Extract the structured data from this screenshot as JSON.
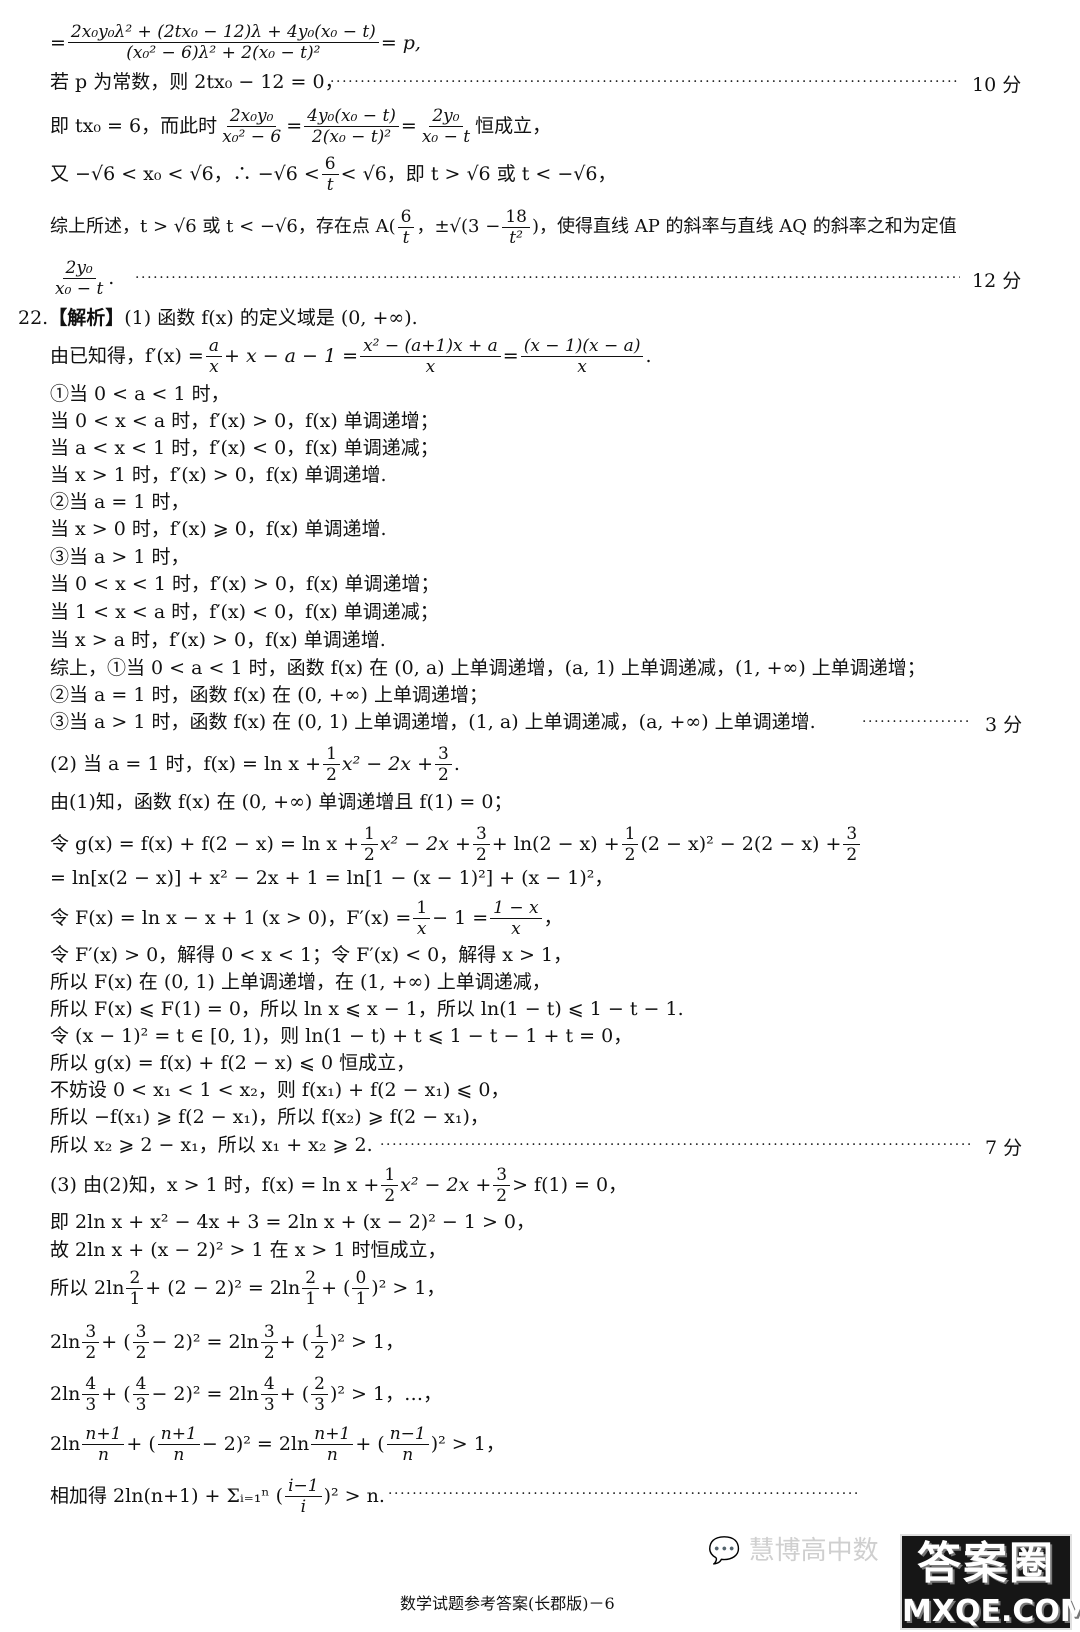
{
  "page": {
    "lines": {
      "l01": {
        "pre": "=",
        "frac_num": "2x₀y₀λ² + (2tx₀ − 12)λ + 4y₀(x₀ − t)",
        "frac_den": "(x₀² − 6)λ² + 2(x₀ − t)²",
        "post": "= p,"
      },
      "l02": {
        "text": "若 p 为常数，则 2tx₀ − 12 = 0，",
        "score": "10 分"
      },
      "l03": {
        "pre": "即 tx₀ = 6，而此时",
        "f1_num": "2x₀y₀",
        "f1_den": "x₀² − 6",
        "eq1": "=",
        "f2_num": "4y₀(x₀ − t)",
        "f2_den": "2(x₀ − t)²",
        "eq2": "=",
        "f3_num": "2y₀",
        "f3_den": "x₀ − t",
        "post": "恒成立，"
      },
      "l04": {
        "pre": "又 −√6 < x₀ < √6，∴ −√6 <",
        "f_num": "6",
        "f_den": "t",
        "post": "< √6，即 t > √6 或 t < −√6，"
      },
      "l05": {
        "pre": "综上所述，t > √6 或 t < −√6，存在点 A(",
        "f1_num": "6",
        "f1_den": "t",
        "mid": "，±√(3 −",
        "f2_num": "18",
        "f2_den": "t²",
        "post": ")，使得直线 AP 的斜率与直线 AQ 的斜率之和为定值"
      },
      "l06": {
        "f_num": "2y₀",
        "f_den": "x₀ − t",
        "post": ".",
        "score": "12 分"
      },
      "l07": {
        "num": "22.",
        "tag": "【解析】",
        "text": "(1) 函数 f(x) 的定义域是 (0, +∞)."
      },
      "l08": {
        "pre": "由已知得，f′(x) =",
        "f1_num": "a",
        "f1_den": "x",
        "mid": "+ x − a − 1 =",
        "f2_num": "x² − (a+1)x + a",
        "f2_den": "x",
        "eq": "=",
        "f3_num": "(x − 1)(x − a)",
        "f3_den": "x",
        "post": "."
      },
      "l09": {
        "text": "①当 0 < a < 1 时，"
      },
      "l10": {
        "text": "当 0 < x < a 时，f′(x) > 0，f(x) 单调递增；"
      },
      "l11": {
        "text": "当 a < x < 1 时，f′(x) < 0，f(x) 单调递减；"
      },
      "l12": {
        "text": "当 x > 1 时，f′(x) > 0，f(x) 单调递增."
      },
      "l13": {
        "text": "②当 a = 1 时，"
      },
      "l14": {
        "text": "当 x > 0 时，f′(x) ⩾ 0，f(x) 单调递增."
      },
      "l15": {
        "text": "③当 a > 1 时，"
      },
      "l16": {
        "text": "当 0 < x < 1 时，f′(x) > 0，f(x) 单调递增；"
      },
      "l17": {
        "text": "当 1 < x < a 时，f′(x) < 0，f(x) 单调递减；"
      },
      "l18": {
        "text": "当 x > a 时，f′(x) > 0，f(x) 单调递增."
      },
      "l19": {
        "text": "综上，①当 0 < a < 1 时，函数 f(x) 在 (0, a) 上单调递增，(a, 1) 上单调递减，(1, +∞) 上单调递增；"
      },
      "l20": {
        "text": "②当 a = 1 时，函数 f(x) 在 (0, +∞) 上单调递增；"
      },
      "l21": {
        "text": "③当 a > 1 时，函数 f(x) 在 (0, 1) 上单调递增，(1, a) 上单调递减，(a, +∞) 上单调递增.",
        "score": "3 分"
      },
      "l22": {
        "pre": "(2) 当 a = 1 时，f(x) = ln x +",
        "f1_num": "1",
        "f1_den": "2",
        "mid": "x² − 2x +",
        "f2_num": "3",
        "f2_den": "2",
        "post": "."
      },
      "l23": {
        "text": "由(1)知，函数 f(x) 在 (0, +∞) 单调递增且 f(1) = 0；"
      },
      "l24": {
        "pre": "令 g(x) = f(x) + f(2 − x) = ln x +",
        "f1_num": "1",
        "f1_den": "2",
        "mid1": "x² − 2x +",
        "f2_num": "3",
        "f2_den": "2",
        "mid2": "+ ln(2 − x) +",
        "f3_num": "1",
        "f3_den": "2",
        "mid3": "(2 − x)² − 2(2 − x) +",
        "f4_num": "3",
        "f4_den": "2"
      },
      "l25": {
        "text": "= ln[x(2 − x)] + x² − 2x + 1 = ln[1 − (x − 1)²] + (x − 1)²，"
      },
      "l26": {
        "pre": "令 F(x) = ln x − x + 1 (x > 0)，F′(x) =",
        "f1_num": "1",
        "f1_den": "x",
        "mid": "− 1 =",
        "f2_num": "1 − x",
        "f2_den": "x",
        "post": "，"
      },
      "l27": {
        "text": "令 F′(x) > 0，解得 0 < x < 1；令 F′(x) < 0，解得 x > 1，"
      },
      "l28": {
        "text": "所以 F(x) 在 (0, 1) 上单调递增，在 (1, +∞) 上单调递减，"
      },
      "l29": {
        "text": "所以 F(x) ⩽ F(1) = 0，所以 ln x ⩽ x − 1，所以 ln(1 − t) ⩽ 1 − t − 1."
      },
      "l30": {
        "text": "令 (x − 1)² = t ∈ [0, 1)，则 ln(1 − t) + t ⩽ 1 − t − 1 + t = 0，"
      },
      "l31": {
        "text": "所以 g(x) = f(x) + f(2 − x) ⩽ 0 恒成立，"
      },
      "l32": {
        "text": "不妨设 0 < x₁ < 1 < x₂，则 f(x₁) + f(2 − x₁) ⩽ 0，"
      },
      "l33": {
        "text": "所以 −f(x₁) ⩾ f(2 − x₁)，所以 f(x₂) ⩾ f(2 − x₁)，"
      },
      "l34": {
        "text": "所以 x₂ ⩾ 2 − x₁，所以 x₁ + x₂ ⩾ 2.",
        "score": "7 分"
      },
      "l35": {
        "pre": "(3) 由(2)知，x > 1 时，f(x) = ln x +",
        "f1_num": "1",
        "f1_den": "2",
        "mid": "x² − 2x +",
        "f2_num": "3",
        "f2_den": "2",
        "post": "> f(1) = 0，"
      },
      "l36": {
        "text": "即 2ln x + x² − 4x + 3 = 2ln x + (x − 2)² − 1 > 0，"
      },
      "l37": {
        "text": "故 2ln x + (x − 2)² > 1 在 x > 1 时恒成立，"
      },
      "l38": {
        "pre": "所以 2ln",
        "f1_num": "2",
        "f1_den": "1",
        "mid1": "+ (2 − 2)² = 2ln",
        "f2_num": "2",
        "f2_den": "1",
        "mid2": "+ (",
        "f3_num": "0",
        "f3_den": "1",
        "post": ")² > 1，"
      },
      "l39": {
        "pre": "2ln",
        "f1_num": "3",
        "f1_den": "2",
        "mid1": "+ (",
        "f2_num": "3",
        "f2_den": "2",
        "mid2": "− 2)² = 2ln",
        "f3_num": "3",
        "f3_den": "2",
        "mid3": "+ (",
        "f4_num": "1",
        "f4_den": "2",
        "post": ")² > 1，"
      },
      "l40": {
        "pre": "2ln",
        "f1_num": "4",
        "f1_den": "3",
        "mid1": "+ (",
        "f2_num": "4",
        "f2_den": "3",
        "mid2": "− 2)² = 2ln",
        "f3_num": "4",
        "f3_den": "3",
        "mid3": "+ (",
        "f4_num": "2",
        "f4_den": "3",
        "post": ")² > 1，…，"
      },
      "l41": {
        "pre": "2ln",
        "f1_num": "n+1",
        "f1_den": "n",
        "mid1": "+ (",
        "f2_num": "n+1",
        "f2_den": "n",
        "mid2": "− 2)² = 2ln",
        "f3_num": "n+1",
        "f3_den": "n",
        "mid3": "+ (",
        "f4_num": "n−1",
        "f4_den": "n",
        "post": ")² > 1，"
      },
      "l42": {
        "pre": "相加得 2ln(n+1) + Σᵢ₌₁ⁿ (",
        "f_num": "i−1",
        "f_den": "i",
        "post": ")² > n."
      }
    },
    "footer": "数学试题参考答案(长郡版)－6",
    "watermark": {
      "wechat_text": "慧博高中数",
      "box_top": "答案圈",
      "box_bottom": "MXQE.COM"
    }
  }
}
